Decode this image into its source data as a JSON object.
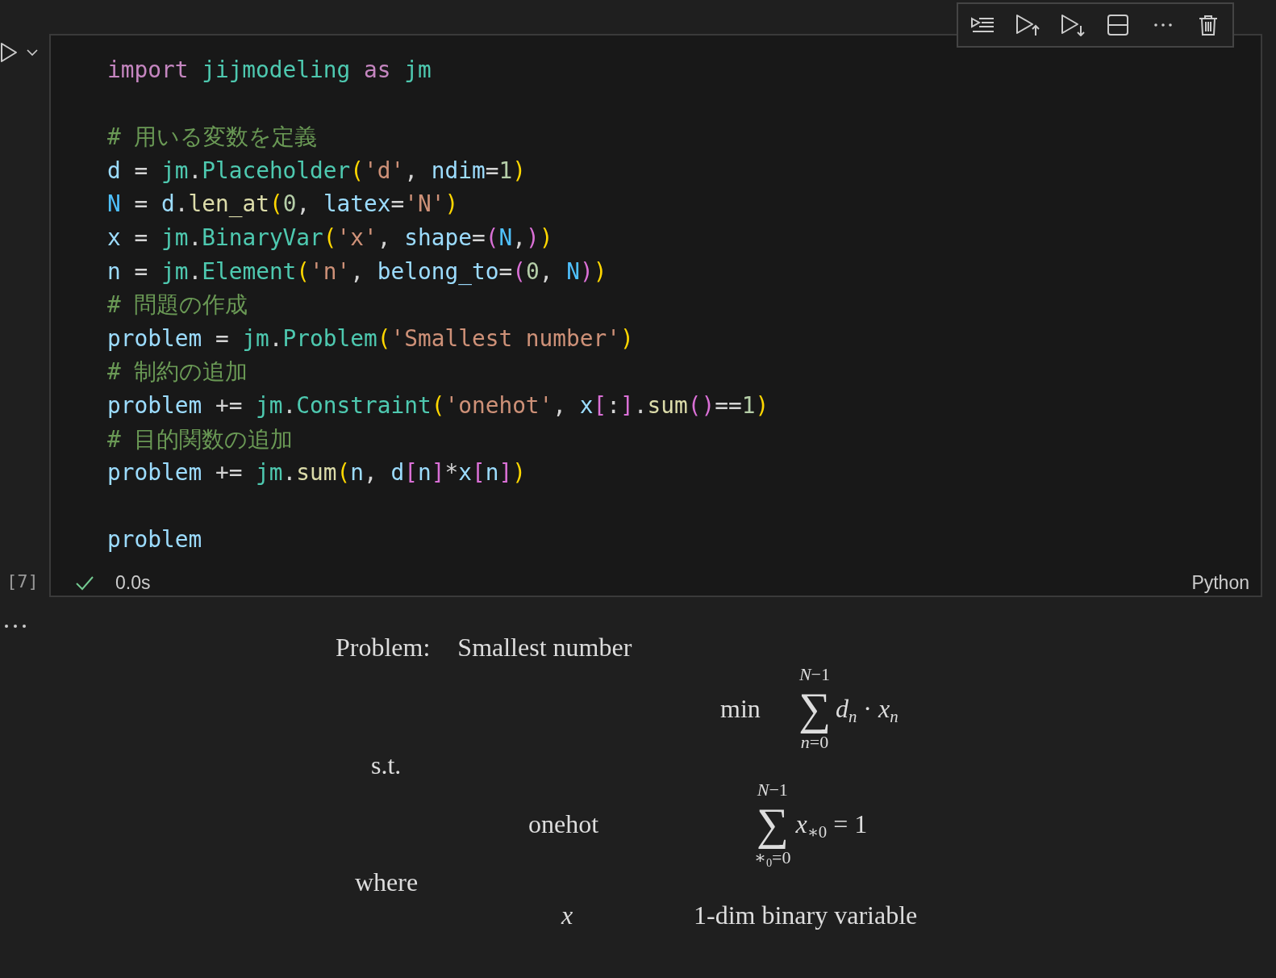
{
  "cell": {
    "execution_count": "[7]",
    "language": "Python",
    "status": {
      "success": true,
      "duration": "0.0s"
    },
    "code": [
      {
        "blank_line_after": true,
        "tokens": [
          {
            "text": "import ",
            "kind": "keyword"
          },
          {
            "text": "jijmodeling ",
            "kind": "module"
          },
          {
            "text": "as ",
            "kind": "keyword"
          },
          {
            "text": "jm",
            "kind": "module"
          }
        ]
      },
      {
        "tokens": [
          {
            "text": "# 用いる変数を定義",
            "kind": "comment"
          }
        ]
      },
      {
        "tokens": [
          {
            "text": "d",
            "kind": "var"
          },
          {
            "text": " = ",
            "kind": "plain"
          },
          {
            "text": "jm",
            "kind": "module"
          },
          {
            "text": ".",
            "kind": "plain"
          },
          {
            "text": "Placeholder",
            "kind": "class"
          },
          {
            "text": "(",
            "kind": "b1"
          },
          {
            "text": "'d'",
            "kind": "string"
          },
          {
            "text": ", ",
            "kind": "plain"
          },
          {
            "text": "ndim",
            "kind": "var"
          },
          {
            "text": "=",
            "kind": "plain"
          },
          {
            "text": "1",
            "kind": "number"
          },
          {
            "text": ")",
            "kind": "b1"
          }
        ]
      },
      {
        "tokens": [
          {
            "text": "N",
            "kind": "const"
          },
          {
            "text": " = ",
            "kind": "plain"
          },
          {
            "text": "d",
            "kind": "var"
          },
          {
            "text": ".",
            "kind": "plain"
          },
          {
            "text": "len_at",
            "kind": "func"
          },
          {
            "text": "(",
            "kind": "b1"
          },
          {
            "text": "0",
            "kind": "number"
          },
          {
            "text": ", ",
            "kind": "plain"
          },
          {
            "text": "latex",
            "kind": "var"
          },
          {
            "text": "=",
            "kind": "plain"
          },
          {
            "text": "'N'",
            "kind": "string"
          },
          {
            "text": ")",
            "kind": "b1"
          }
        ]
      },
      {
        "tokens": [
          {
            "text": "x",
            "kind": "var"
          },
          {
            "text": " = ",
            "kind": "plain"
          },
          {
            "text": "jm",
            "kind": "module"
          },
          {
            "text": ".",
            "kind": "plain"
          },
          {
            "text": "BinaryVar",
            "kind": "class"
          },
          {
            "text": "(",
            "kind": "b1"
          },
          {
            "text": "'x'",
            "kind": "string"
          },
          {
            "text": ", ",
            "kind": "plain"
          },
          {
            "text": "shape",
            "kind": "var"
          },
          {
            "text": "=",
            "kind": "plain"
          },
          {
            "text": "(",
            "kind": "b2"
          },
          {
            "text": "N",
            "kind": "const"
          },
          {
            "text": ",",
            "kind": "plain"
          },
          {
            "text": ")",
            "kind": "b2"
          },
          {
            "text": ")",
            "kind": "b1"
          }
        ]
      },
      {
        "tokens": [
          {
            "text": "n",
            "kind": "var"
          },
          {
            "text": " = ",
            "kind": "plain"
          },
          {
            "text": "jm",
            "kind": "module"
          },
          {
            "text": ".",
            "kind": "plain"
          },
          {
            "text": "Element",
            "kind": "class"
          },
          {
            "text": "(",
            "kind": "b1"
          },
          {
            "text": "'n'",
            "kind": "string"
          },
          {
            "text": ", ",
            "kind": "plain"
          },
          {
            "text": "belong_to",
            "kind": "var"
          },
          {
            "text": "=",
            "kind": "plain"
          },
          {
            "text": "(",
            "kind": "b2"
          },
          {
            "text": "0",
            "kind": "number"
          },
          {
            "text": ", ",
            "kind": "plain"
          },
          {
            "text": "N",
            "kind": "const"
          },
          {
            "text": ")",
            "kind": "b2"
          },
          {
            "text": ")",
            "kind": "b1"
          }
        ]
      },
      {
        "tokens": [
          {
            "text": "# 問題の作成",
            "kind": "comment"
          }
        ]
      },
      {
        "tokens": [
          {
            "text": "problem",
            "kind": "var"
          },
          {
            "text": " = ",
            "kind": "plain"
          },
          {
            "text": "jm",
            "kind": "module"
          },
          {
            "text": ".",
            "kind": "plain"
          },
          {
            "text": "Problem",
            "kind": "class"
          },
          {
            "text": "(",
            "kind": "b1"
          },
          {
            "text": "'Smallest number'",
            "kind": "string"
          },
          {
            "text": ")",
            "kind": "b1"
          }
        ]
      },
      {
        "tokens": [
          {
            "text": "# 制約の追加",
            "kind": "comment"
          }
        ]
      },
      {
        "tokens": [
          {
            "text": "problem",
            "kind": "var"
          },
          {
            "text": " += ",
            "kind": "plain"
          },
          {
            "text": "jm",
            "kind": "module"
          },
          {
            "text": ".",
            "kind": "plain"
          },
          {
            "text": "Constraint",
            "kind": "class"
          },
          {
            "text": "(",
            "kind": "b1"
          },
          {
            "text": "'onehot'",
            "kind": "string"
          },
          {
            "text": ", ",
            "kind": "plain"
          },
          {
            "text": "x",
            "kind": "var"
          },
          {
            "text": "[",
            "kind": "b2"
          },
          {
            "text": ":",
            "kind": "plain"
          },
          {
            "text": "]",
            "kind": "b2"
          },
          {
            "text": ".",
            "kind": "plain"
          },
          {
            "text": "sum",
            "kind": "func"
          },
          {
            "text": "()",
            "kind": "b2"
          },
          {
            "text": "==",
            "kind": "plain"
          },
          {
            "text": "1",
            "kind": "number"
          },
          {
            "text": ")",
            "kind": "b1"
          }
        ]
      },
      {
        "tokens": [
          {
            "text": "# 目的関数の追加",
            "kind": "comment"
          }
        ]
      },
      {
        "blank_line_after": true,
        "tokens": [
          {
            "text": "problem",
            "kind": "var"
          },
          {
            "text": " += ",
            "kind": "plain"
          },
          {
            "text": "jm",
            "kind": "module"
          },
          {
            "text": ".",
            "kind": "plain"
          },
          {
            "text": "sum",
            "kind": "func"
          },
          {
            "text": "(",
            "kind": "b1"
          },
          {
            "text": "n",
            "kind": "var"
          },
          {
            "text": ", ",
            "kind": "plain"
          },
          {
            "text": "d",
            "kind": "var"
          },
          {
            "text": "[",
            "kind": "b2"
          },
          {
            "text": "n",
            "kind": "var"
          },
          {
            "text": "]",
            "kind": "b2"
          },
          {
            "text": "*",
            "kind": "plain"
          },
          {
            "text": "x",
            "kind": "var"
          },
          {
            "text": "[",
            "kind": "b2"
          },
          {
            "text": "n",
            "kind": "var"
          },
          {
            "text": "]",
            "kind": "b2"
          },
          {
            "text": ")",
            "kind": "b1"
          }
        ]
      },
      {
        "tokens": [
          {
            "text": "problem",
            "kind": "var"
          }
        ]
      }
    ]
  },
  "output": {
    "problem_label": "Problem:",
    "problem_name": "Smallest number",
    "objective": {
      "label": "min",
      "upper": "*N*−1",
      "operator": "∑",
      "lower": "*n*=0",
      "expression": "*d*$_{n}$ · *x*$_{n}$"
    },
    "constraints_label": "s.t.",
    "constraints": [
      {
        "name": "onehot",
        "upper": "*N*−1",
        "operator": "∑",
        "lower": "∗$_{0}$=0",
        "expression": "*x*$_{∗0}$ = 1"
      }
    ],
    "where_label": "where",
    "variables": [
      {
        "symbol": "x",
        "description": "1-dim binary variable"
      }
    ]
  }
}
